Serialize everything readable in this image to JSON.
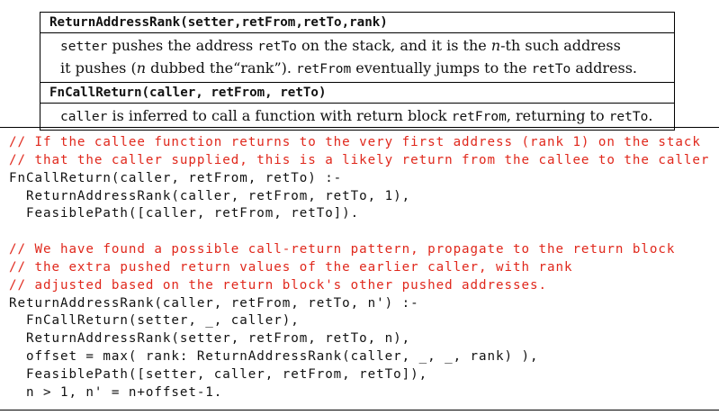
{
  "relations": [
    {
      "header": "ReturnAddressRank(setter,retFrom,retTo,rank)",
      "desc_lines": [
        [
          {
            "t": "setter",
            "s": "mono"
          },
          {
            "t": " pushes the address ",
            "s": "text"
          },
          {
            "t": "retTo",
            "s": "mono"
          },
          {
            "t": " on the stack, and it is the ",
            "s": "text"
          },
          {
            "t": "n",
            "s": "ital"
          },
          {
            "t": "-th such address",
            "s": "text"
          }
        ],
        [
          {
            "t": "it pushes (",
            "s": "text"
          },
          {
            "t": "n",
            "s": "ital"
          },
          {
            "t": " dubbed the“rank”). ",
            "s": "text"
          },
          {
            "t": "retFrom",
            "s": "mono"
          },
          {
            "t": " eventually jumps to the ",
            "s": "text"
          },
          {
            "t": "retTo",
            "s": "mono"
          },
          {
            "t": " address.",
            "s": "text"
          }
        ]
      ]
    },
    {
      "header": "FnCallReturn(caller, retFrom, retTo)",
      "desc_lines": [
        [
          {
            "t": "caller",
            "s": "mono"
          },
          {
            "t": " is inferred to call a function with return block ",
            "s": "text"
          },
          {
            "t": "retFrom",
            "s": "mono"
          },
          {
            "t": ", returning to ",
            "s": "text"
          },
          {
            "t": "retTo",
            "s": "mono"
          },
          {
            "t": ".",
            "s": "text"
          }
        ]
      ]
    }
  ],
  "code_lines": [
    {
      "text": "// If the callee function returns to the very first address (rank 1) on the stack",
      "kind": "comment"
    },
    {
      "text": "// that the caller supplied, this is a likely return from the callee to the caller",
      "kind": "comment"
    },
    {
      "text": "FnCallReturn(caller, retFrom, retTo) :-",
      "kind": "code"
    },
    {
      "text": "  ReturnAddressRank(caller, retFrom, retTo, 1),",
      "kind": "code"
    },
    {
      "text": "  FeasiblePath([caller, retFrom, retTo]).",
      "kind": "code"
    },
    {
      "text": "",
      "kind": "blank"
    },
    {
      "text": "// We have found a possible call-return pattern, propagate to the return block",
      "kind": "comment"
    },
    {
      "text": "// the extra pushed return values of the earlier caller, with rank",
      "kind": "comment"
    },
    {
      "text": "// adjusted based on the return block's other pushed addresses.",
      "kind": "comment"
    },
    {
      "text": "ReturnAddressRank(caller, retFrom, retTo, n') :-",
      "kind": "code"
    },
    {
      "text": "  FnCallReturn(setter, _, caller),",
      "kind": "code"
    },
    {
      "text": "  ReturnAddressRank(setter, retFrom, retTo, n),",
      "kind": "code"
    },
    {
      "text": "  offset = max( rank: ReturnAddressRank(caller, _, _, rank) ),",
      "kind": "code"
    },
    {
      "text": "  FeasiblePath([setter, caller, retFrom, retTo]),",
      "kind": "code"
    },
    {
      "text": "  n > 1, n' = n+offset-1.",
      "kind": "code"
    }
  ]
}
